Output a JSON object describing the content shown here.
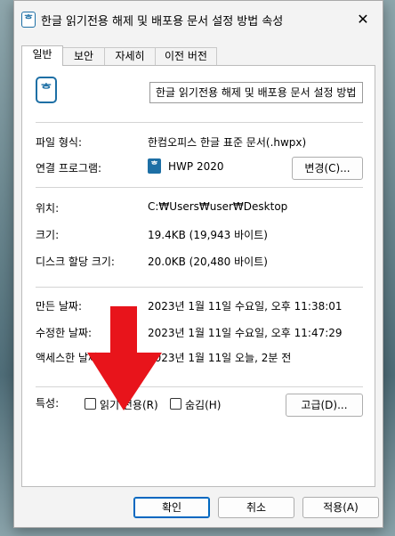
{
  "window": {
    "title": "한글 읽기전용 해제 및 배포용 문서 설정 방법 속성",
    "close_glyph": "✕",
    "icon_glyph": "ᄒ"
  },
  "tabs": [
    {
      "label": "일반"
    },
    {
      "label": "보안"
    },
    {
      "label": "자세히"
    },
    {
      "label": "이전 버전"
    }
  ],
  "general": {
    "file_name": "한글 읽기전용 해제 및 배포용 문서 설정 방법",
    "file_icon_glyph": "ᄒ",
    "file_type_label": "파일 형식:",
    "file_type_value": "한컴오피스 한글 표준 문서(.hwpx)",
    "open_with_label": "연결 프로그램:",
    "open_with_value": "HWP 2020",
    "open_with_icon_glyph": "ᄒ",
    "change_button": "변경(C)...",
    "location_label": "위치:",
    "location_value": "C:₩Users₩user₩Desktop",
    "size_label": "크기:",
    "size_value": "19.4KB (19,943 바이트)",
    "disk_size_label": "디스크 할당 크기:",
    "disk_size_value": "20.0KB (20,480 바이트)",
    "created_label": "만든 날짜:",
    "created_value": "2023년 1월 11일 수요일, 오후 11:38:01",
    "modified_label": "수정한 날짜:",
    "modified_value": "2023년 1월 11일 수요일, 오후 11:47:29",
    "accessed_label": "액세스한 날짜:",
    "accessed_value": "2023년 1월 11일 오늘, 2분 전",
    "attributes_label": "특성:",
    "readonly_label": "읽기 전용(R)",
    "hidden_label": "숨김(H)",
    "advanced_button": "고급(D)..."
  },
  "footer": {
    "ok": "확인",
    "cancel": "취소",
    "apply": "적용(A)"
  },
  "colors": {
    "annotation_arrow": "#e8141b",
    "accent": "#0067c0"
  }
}
